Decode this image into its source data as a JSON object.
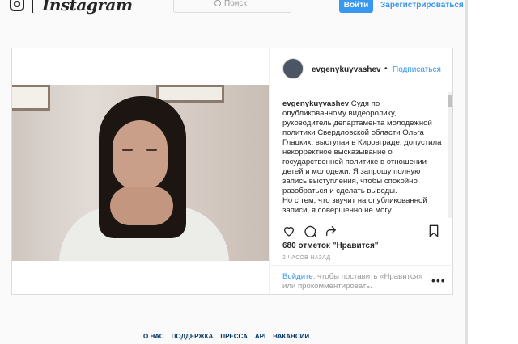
{
  "header": {
    "logo_text": "Instagram",
    "search_placeholder": "Поиск",
    "login_label": "Войти",
    "signup_label": "Зарегистрироваться"
  },
  "post": {
    "username": "evgenykuyvashev",
    "separator": "•",
    "follow_label": "Подписаться",
    "caption_user": "evgenykuyvashev",
    "caption_text": " Судя по опубликованному видеоролику, руководитель департамента молодежной политики Свердловской области Ольга Глацких, выступая в Кировграде, допустила некорректное высказывание о государственной политике в отношении детей и молодежи. Я запрошу полную запись выступления, чтобы спокойно разобраться и сделать выводы.",
    "caption_text_2": "Но с тем, что звучит на опубликованной записи, я совершенно не могу",
    "likes": "680 отметок \"Нравится\"",
    "timestamp": "2 ЧАСОВ НАЗАД",
    "login_link": "Войдите",
    "login_prompt_rest": ", чтобы поставить «Нравится» или прокомментировать.",
    "more_label": "•••"
  },
  "footer": {
    "links": [
      "О НАС",
      "ПОДДЕРЖКА",
      "ПРЕССА",
      "API",
      "ВАКАНСИИ"
    ]
  }
}
